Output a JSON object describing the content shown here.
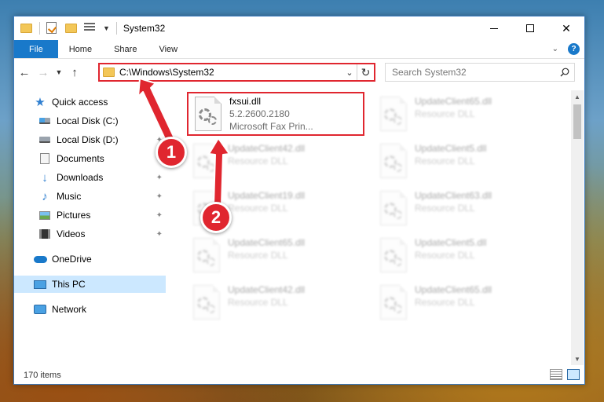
{
  "window": {
    "title": "System32"
  },
  "ribbon": {
    "tabs": [
      "File",
      "Home",
      "Share",
      "View"
    ]
  },
  "address": {
    "path": "C:\\Windows\\System32"
  },
  "search": {
    "placeholder": "Search System32"
  },
  "sidebar": {
    "items": [
      {
        "label": "Quick access",
        "icon": "star-icon",
        "pinned": false
      },
      {
        "label": "Local Disk (C:)",
        "icon": "drive-icon",
        "pinned": true
      },
      {
        "label": "Local Disk (D:)",
        "icon": "drive-icon",
        "pinned": true
      },
      {
        "label": "Documents",
        "icon": "documents-icon",
        "pinned": true
      },
      {
        "label": "Downloads",
        "icon": "download-icon",
        "pinned": true
      },
      {
        "label": "Music",
        "icon": "music-icon",
        "pinned": true
      },
      {
        "label": "Pictures",
        "icon": "pictures-icon",
        "pinned": true
      },
      {
        "label": "Videos",
        "icon": "videos-icon",
        "pinned": true
      },
      {
        "label": "OneDrive",
        "icon": "cloud-icon",
        "pinned": false
      },
      {
        "label": "This PC",
        "icon": "computer-icon",
        "pinned": false,
        "selected": true
      },
      {
        "label": "Network",
        "icon": "network-icon",
        "pinned": false
      }
    ]
  },
  "files": {
    "highlighted": {
      "name": "fxsui.dll",
      "version": "5.2.2600.2180",
      "description": "Microsoft  Fax Prin..."
    },
    "ghosts": [
      {
        "name": "UpdateClient65.dll",
        "type": "Resource DLL"
      },
      {
        "name": "UpdateClient42.dll",
        "type": "Resource DLL"
      },
      {
        "name": "UpdateClient5.dll",
        "type": "Resource DLL"
      },
      {
        "name": "UpdateClient19.dll",
        "type": "Resource DLL"
      },
      {
        "name": "UpdateClient63.dll",
        "type": "Resource DLL"
      },
      {
        "name": "UpdateClient65.dll",
        "type": "Resource DLL"
      },
      {
        "name": "UpdateClient5.dll",
        "type": "Resource DLL"
      },
      {
        "name": "UpdateClient42.dll",
        "type": "Resource DLL"
      },
      {
        "name": "UpdateClient65.dll",
        "type": "Resource DLL"
      }
    ]
  },
  "status": {
    "item_count": "170 items"
  },
  "callouts": {
    "one": "1",
    "two": "2"
  },
  "colors": {
    "accent": "#1979ca",
    "highlight_red": "#e0262f",
    "selection": "#cce8ff"
  }
}
